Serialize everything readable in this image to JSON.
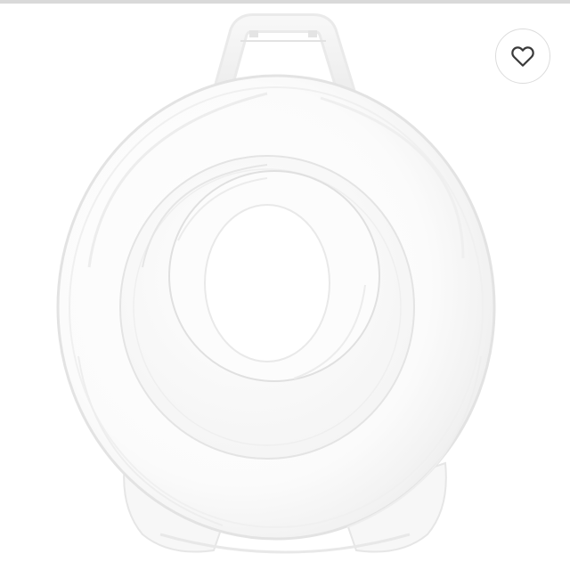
{
  "product": {
    "image_icon": "round-clear-plastic-carrying-case-with-handle"
  },
  "favorite": {
    "icon": "heart-outline-icon",
    "state": "not-favorited",
    "icon_color": "#3a3a3a",
    "border_color": "#dcdcdc"
  },
  "colors": {
    "background": "#ffffff",
    "top_bar": "#d9d9d9"
  }
}
